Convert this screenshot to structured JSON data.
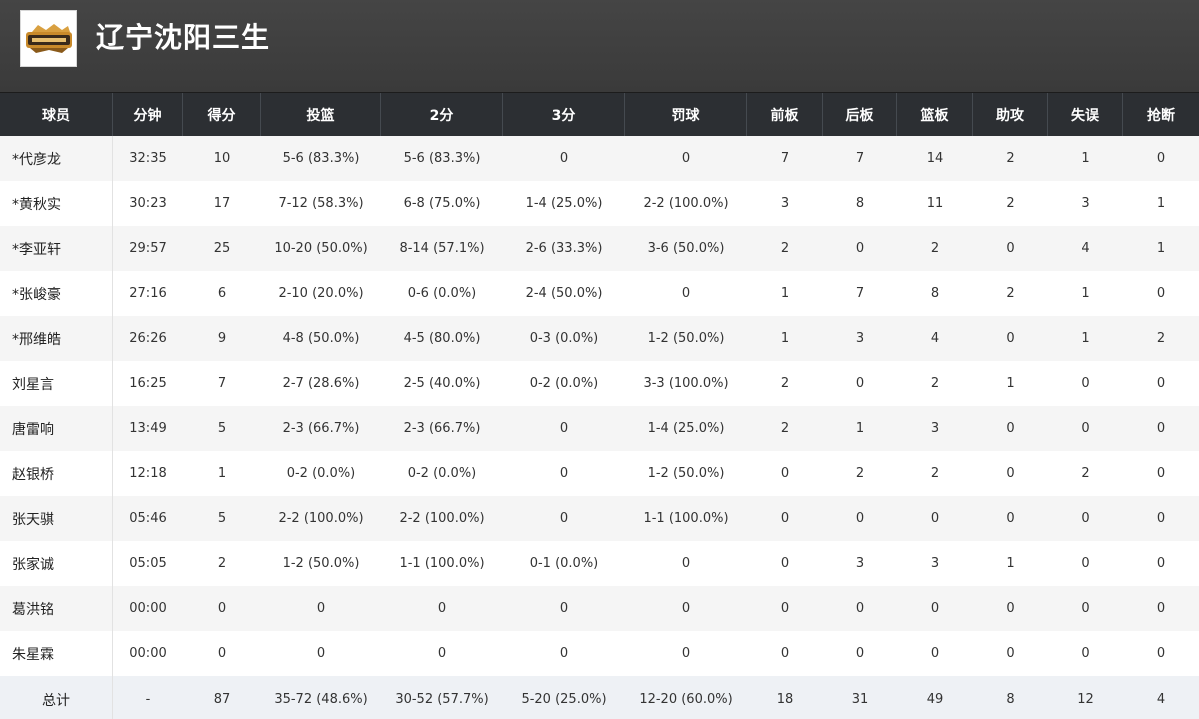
{
  "team": {
    "name": "辽宁沈阳三生",
    "logo_icon": "team-logo-icon"
  },
  "table": {
    "headers": [
      "球员",
      "分钟",
      "得分",
      "投篮",
      "2分",
      "3分",
      "罚球",
      "前板",
      "后板",
      "篮板",
      "助攻",
      "失误",
      "抢断"
    ],
    "rows": [
      [
        "*代彦龙",
        "32:35",
        "10",
        "5-6 (83.3%)",
        "5-6 (83.3%)",
        "0",
        "0",
        "7",
        "7",
        "14",
        "2",
        "1",
        "0"
      ],
      [
        "*黄秋实",
        "30:23",
        "17",
        "7-12 (58.3%)",
        "6-8 (75.0%)",
        "1-4 (25.0%)",
        "2-2 (100.0%)",
        "3",
        "8",
        "11",
        "2",
        "3",
        "1"
      ],
      [
        "*李亚轩",
        "29:57",
        "25",
        "10-20 (50.0%)",
        "8-14 (57.1%)",
        "2-6 (33.3%)",
        "3-6 (50.0%)",
        "2",
        "0",
        "2",
        "0",
        "4",
        "1"
      ],
      [
        "*张峻豪",
        "27:16",
        "6",
        "2-10 (20.0%)",
        "0-6 (0.0%)",
        "2-4 (50.0%)",
        "0",
        "1",
        "7",
        "8",
        "2",
        "1",
        "0"
      ],
      [
        "*邢维皓",
        "26:26",
        "9",
        "4-8 (50.0%)",
        "4-5 (80.0%)",
        "0-3 (0.0%)",
        "1-2 (50.0%)",
        "1",
        "3",
        "4",
        "0",
        "1",
        "2"
      ],
      [
        "刘星言",
        "16:25",
        "7",
        "2-7 (28.6%)",
        "2-5 (40.0%)",
        "0-2 (0.0%)",
        "3-3 (100.0%)",
        "2",
        "0",
        "2",
        "1",
        "0",
        "0"
      ],
      [
        "唐雷响",
        "13:49",
        "5",
        "2-3 (66.7%)",
        "2-3 (66.7%)",
        "0",
        "1-4 (25.0%)",
        "2",
        "1",
        "3",
        "0",
        "0",
        "0"
      ],
      [
        "赵银桥",
        "12:18",
        "1",
        "0-2 (0.0%)",
        "0-2 (0.0%)",
        "0",
        "1-2 (50.0%)",
        "0",
        "2",
        "2",
        "0",
        "2",
        "0"
      ],
      [
        "张天骐",
        "05:46",
        "5",
        "2-2 (100.0%)",
        "2-2 (100.0%)",
        "0",
        "1-1 (100.0%)",
        "0",
        "0",
        "0",
        "0",
        "0",
        "0"
      ],
      [
        "张家诚",
        "05:05",
        "2",
        "1-2 (50.0%)",
        "1-1 (100.0%)",
        "0-1 (0.0%)",
        "0",
        "0",
        "3",
        "3",
        "1",
        "0",
        "0"
      ],
      [
        "葛洪铭",
        "00:00",
        "0",
        "0",
        "0",
        "0",
        "0",
        "0",
        "0",
        "0",
        "0",
        "0",
        "0"
      ],
      [
        "朱星霖",
        "00:00",
        "0",
        "0",
        "0",
        "0",
        "0",
        "0",
        "0",
        "0",
        "0",
        "0",
        "0"
      ]
    ],
    "total": [
      "总计",
      "-",
      "87",
      "35-72 (48.6%)",
      "30-52 (57.7%)",
      "5-20 (25.0%)",
      "12-20 (60.0%)",
      "18",
      "31",
      "49",
      "8",
      "12",
      "4"
    ]
  },
  "colors": {
    "header_bg": "#3f3f3f",
    "table_header_bg": "#2c2f33",
    "row_alt": "#f5f5f5",
    "total_row": "#eef1f5"
  }
}
